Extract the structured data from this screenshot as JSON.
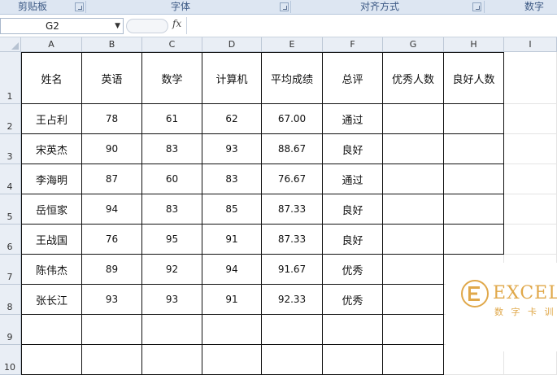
{
  "ribbon": {
    "groups": [
      "剪贴板",
      "字体",
      "对齐方式",
      "数字"
    ]
  },
  "formula_bar": {
    "name_box": "G2",
    "fx_label": "fx",
    "formula": ""
  },
  "sheet": {
    "columns": [
      "A",
      "B",
      "C",
      "D",
      "E",
      "F",
      "G",
      "H",
      "I"
    ],
    "rows": [
      "1",
      "2",
      "3",
      "4",
      "5",
      "6",
      "7",
      "8",
      "9",
      "10"
    ],
    "header": [
      "姓名",
      "英语",
      "数学",
      "计算机",
      "平均成绩",
      "总评",
      "优秀人数",
      "良好人数"
    ],
    "data": [
      [
        "王占利",
        "78",
        "61",
        "62",
        "67.00",
        "通过",
        "",
        ""
      ],
      [
        "宋英杰",
        "90",
        "83",
        "93",
        "88.67",
        "良好",
        "",
        ""
      ],
      [
        "李海明",
        "87",
        "60",
        "83",
        "76.67",
        "通过",
        "",
        ""
      ],
      [
        "岳恒家",
        "94",
        "83",
        "85",
        "87.33",
        "良好",
        "",
        ""
      ],
      [
        "王战国",
        "76",
        "95",
        "91",
        "87.33",
        "良好",
        "",
        ""
      ],
      [
        "陈伟杰",
        "89",
        "92",
        "94",
        "91.67",
        "优秀",
        "",
        ""
      ],
      [
        "张长江",
        "93",
        "93",
        "91",
        "92.33",
        "优秀",
        "",
        ""
      ]
    ]
  },
  "watermark": {
    "title": "EXCEL",
    "subtitle": "数 字 卡 训",
    "color": "#e0a84a"
  }
}
